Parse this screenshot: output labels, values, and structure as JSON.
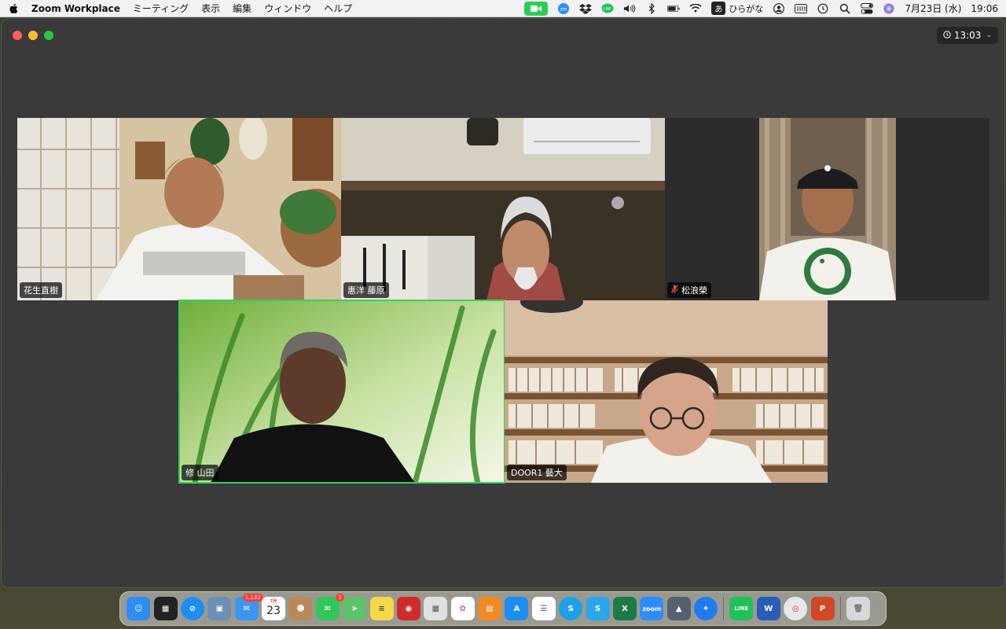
{
  "menubar": {
    "app_name": "Zoom Workplace",
    "menus": [
      "ミーティング",
      "表示",
      "編集",
      "ウィンドウ",
      "ヘルプ"
    ],
    "ime_glyph": "あ",
    "ime_label": "ひらがな",
    "date": "7月23日 (水)",
    "time": "19:06",
    "tray_icons": [
      "zoom-camera-icon",
      "zoom-icon",
      "dropbox-icon",
      "line-icon",
      "volume-icon",
      "bluetooth-icon",
      "battery-icon",
      "wifi-icon",
      "user-icon",
      "memory-icon",
      "history-icon",
      "search-icon",
      "control-center-icon",
      "siri-icon"
    ]
  },
  "zoom": {
    "timer": "13:03",
    "participants": [
      {
        "name": "花生直樹",
        "muted": false,
        "active": false
      },
      {
        "name": "惠洋 藤原",
        "muted": false,
        "active": false
      },
      {
        "name": "松浪榮",
        "muted": true,
        "active": false
      },
      {
        "name": "修 山田",
        "muted": false,
        "active": true
      },
      {
        "name": "DOOR1 藝大",
        "muted": false,
        "active": false
      }
    ]
  },
  "dock": {
    "apps": [
      {
        "name": "finder",
        "color": "#2b8ef0",
        "glyph": "☺"
      },
      {
        "name": "mission-control",
        "color": "#222222",
        "glyph": "▦"
      },
      {
        "name": "safari",
        "color": "#1d8ff2",
        "glyph": "⊘"
      },
      {
        "name": "preview",
        "color": "#6c8fb5",
        "glyph": "▣"
      },
      {
        "name": "mail",
        "color": "#3a95f3",
        "glyph": "✉",
        "badge": "1,132"
      },
      {
        "name": "calendar",
        "color": "#ffffff",
        "month": "7月",
        "day": "23"
      },
      {
        "name": "contacts",
        "color": "#b9895a",
        "glyph": "☻"
      },
      {
        "name": "messages",
        "color": "#32c759",
        "glyph": "✉",
        "badge": "2"
      },
      {
        "name": "maps",
        "color": "#5ec26a",
        "glyph": "➤"
      },
      {
        "name": "notes",
        "color": "#f6d74a",
        "glyph": "≡"
      },
      {
        "name": "photo-booth",
        "color": "#d12a2a",
        "glyph": "◉"
      },
      {
        "name": "launchpad",
        "color": "#e0e0e0",
        "glyph": "▦"
      },
      {
        "name": "photos",
        "color": "#ffffff",
        "glyph": "✿"
      },
      {
        "name": "books",
        "color": "#f08a24",
        "glyph": "▤"
      },
      {
        "name": "app-store",
        "color": "#1c8df5",
        "glyph": "A"
      },
      {
        "name": "reminders",
        "color": "#ffffff",
        "glyph": "☰"
      },
      {
        "name": "skype",
        "color": "#1aa1e8",
        "glyph": "S"
      },
      {
        "name": "skype-for-business",
        "color": "#2aa6ee",
        "glyph": "S"
      },
      {
        "name": "excel",
        "color": "#1d7a45",
        "glyph": "X"
      },
      {
        "name": "zoom",
        "color": "#2d8cff",
        "glyph": "zoom"
      },
      {
        "name": "google-drive",
        "color": "#556070",
        "glyph": "▲"
      },
      {
        "name": "messenger",
        "color": "#1e7cf2",
        "glyph": "✦"
      },
      {
        "name": "line",
        "color": "#21c15a",
        "glyph": "LINE"
      },
      {
        "name": "word",
        "color": "#2b5cb8",
        "glyph": "W"
      },
      {
        "name": "chrome",
        "color": "#e8e8e8",
        "glyph": "◎"
      },
      {
        "name": "powerpoint",
        "color": "#d24726",
        "glyph": "P"
      },
      {
        "name": "trash",
        "color": "#d8d8d8",
        "glyph": "🗑"
      }
    ]
  }
}
